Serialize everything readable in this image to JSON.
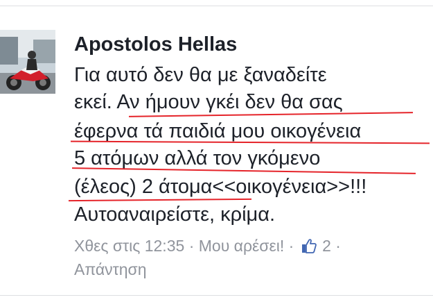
{
  "comment": {
    "author": "Apostolos Hellas",
    "lines": [
      "Για αυτό δεν θα με ξαναδείτε",
      "εκεί. Αν ήμουν γκέι δεν θα σας",
      "έφερνα τά παιδιά μου οικογένεια",
      "5 ατόμων αλλά τον γκόμενο",
      "(έλεος) 2 άτομα<<οικογένεια>>!!!",
      "Αυτοαναιρείστε, κρίμα."
    ],
    "meta": {
      "time": "Χθες στις 12:35",
      "separator": "·",
      "like_label": "Μου αρέσει!",
      "like_icon": "thumbs-up-icon",
      "like_count": "2",
      "reply_label": "Απάντηση"
    },
    "colors": {
      "text": "#1d2129",
      "meta": "#90949c",
      "underline": "#e5242a",
      "like_icon": "#4267b2"
    }
  }
}
